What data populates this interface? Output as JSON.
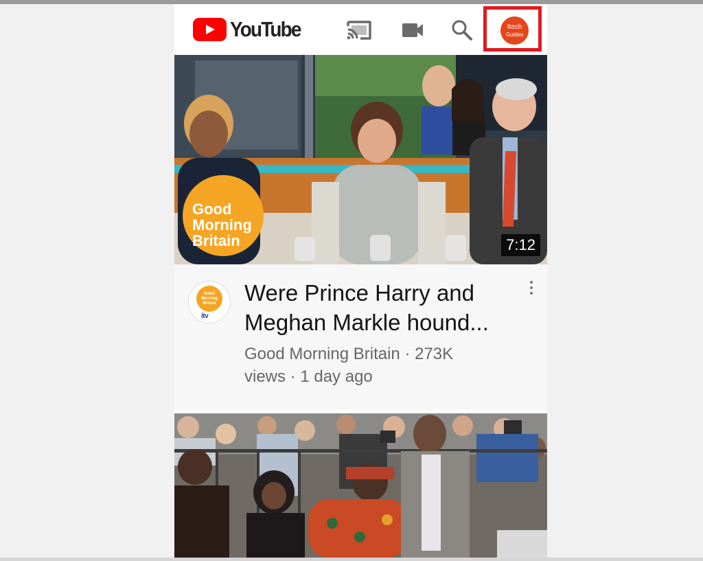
{
  "header": {
    "logo_text": "YouTube",
    "avatar": {
      "line1": "Itech",
      "line2": "Guides"
    },
    "icons": [
      "cast-icon",
      "video-camera-icon",
      "search-icon"
    ],
    "highlight_color": "#e0191f"
  },
  "videos": [
    {
      "thumbnail_badge": {
        "line1": "Good",
        "line2": "Morning",
        "line3": "Britain"
      },
      "duration": "7:12",
      "title_line1": "Were Prince Harry and",
      "title_line2": "Meghan Markle hound...",
      "meta_line1": "Good Morning Britain · 273K",
      "meta_line2": "views · 1 day ago",
      "channel_logo": {
        "line1": "Good",
        "line2": "Morning",
        "line3": "Britain",
        "network": "itv"
      }
    }
  ],
  "colors": {
    "brand_red": "#ff0000",
    "gmb_orange": "#f5a524"
  }
}
